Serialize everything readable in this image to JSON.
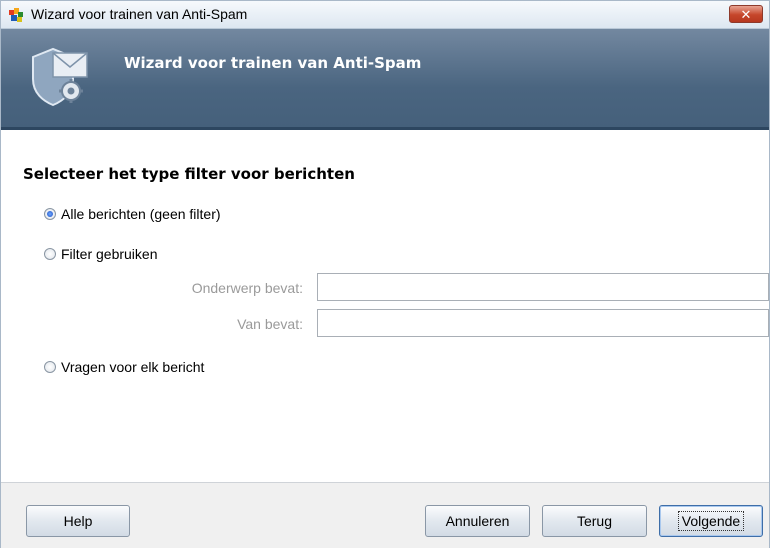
{
  "window": {
    "title": "Wizard voor trainen van Anti-Spam",
    "close_glyph": "✕"
  },
  "banner": {
    "title": "Wizard voor trainen van Anti-Spam",
    "icon": "shield-envelope-gear-icon"
  },
  "main": {
    "heading": "Selecteer het type filter voor berichten",
    "options": [
      {
        "label": "Alle berichten (geen filter)",
        "checked": true
      },
      {
        "label": "Filter gebruiken",
        "checked": false
      },
      {
        "label": "Vragen voor elk bericht",
        "checked": false
      }
    ],
    "filter_fields": [
      {
        "label": "Onderwerp bevat:",
        "value": ""
      },
      {
        "label": "Van bevat:",
        "value": ""
      }
    ]
  },
  "footer": {
    "help": "Help",
    "cancel": "Annuleren",
    "back": "Terug",
    "next": "Volgende"
  },
  "colors": {
    "banner": "#4a6580",
    "close": "#c6462b"
  }
}
